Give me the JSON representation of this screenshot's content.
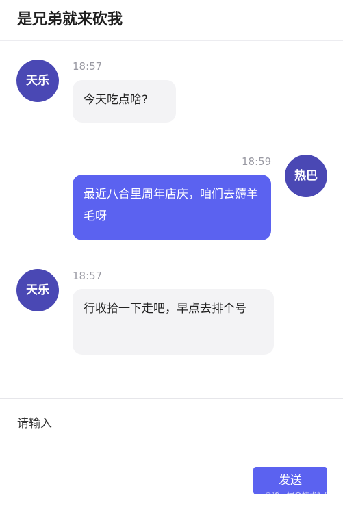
{
  "header": {
    "title": "是兄弟就来砍我"
  },
  "messages": [
    {
      "side": "left",
      "avatar_text": "天乐",
      "time": "18:57",
      "text": "今天吃点啥?"
    },
    {
      "side": "right",
      "avatar_text": "热巴",
      "time": "18:59",
      "text": "最近八合里周年店庆，咱们去薅羊毛呀"
    },
    {
      "side": "left",
      "avatar_text": "天乐",
      "time": "18:57",
      "text": "行收拾一下走吧，早点去排个号"
    }
  ],
  "input": {
    "placeholder": "请输入",
    "value": ""
  },
  "send_button": {
    "label": "发送"
  },
  "watermark": "@稀土掘金技术社区",
  "colors": {
    "avatar": "#4a48b4",
    "accent": "#5b62f0",
    "left_bubble": "#f3f3f5"
  }
}
